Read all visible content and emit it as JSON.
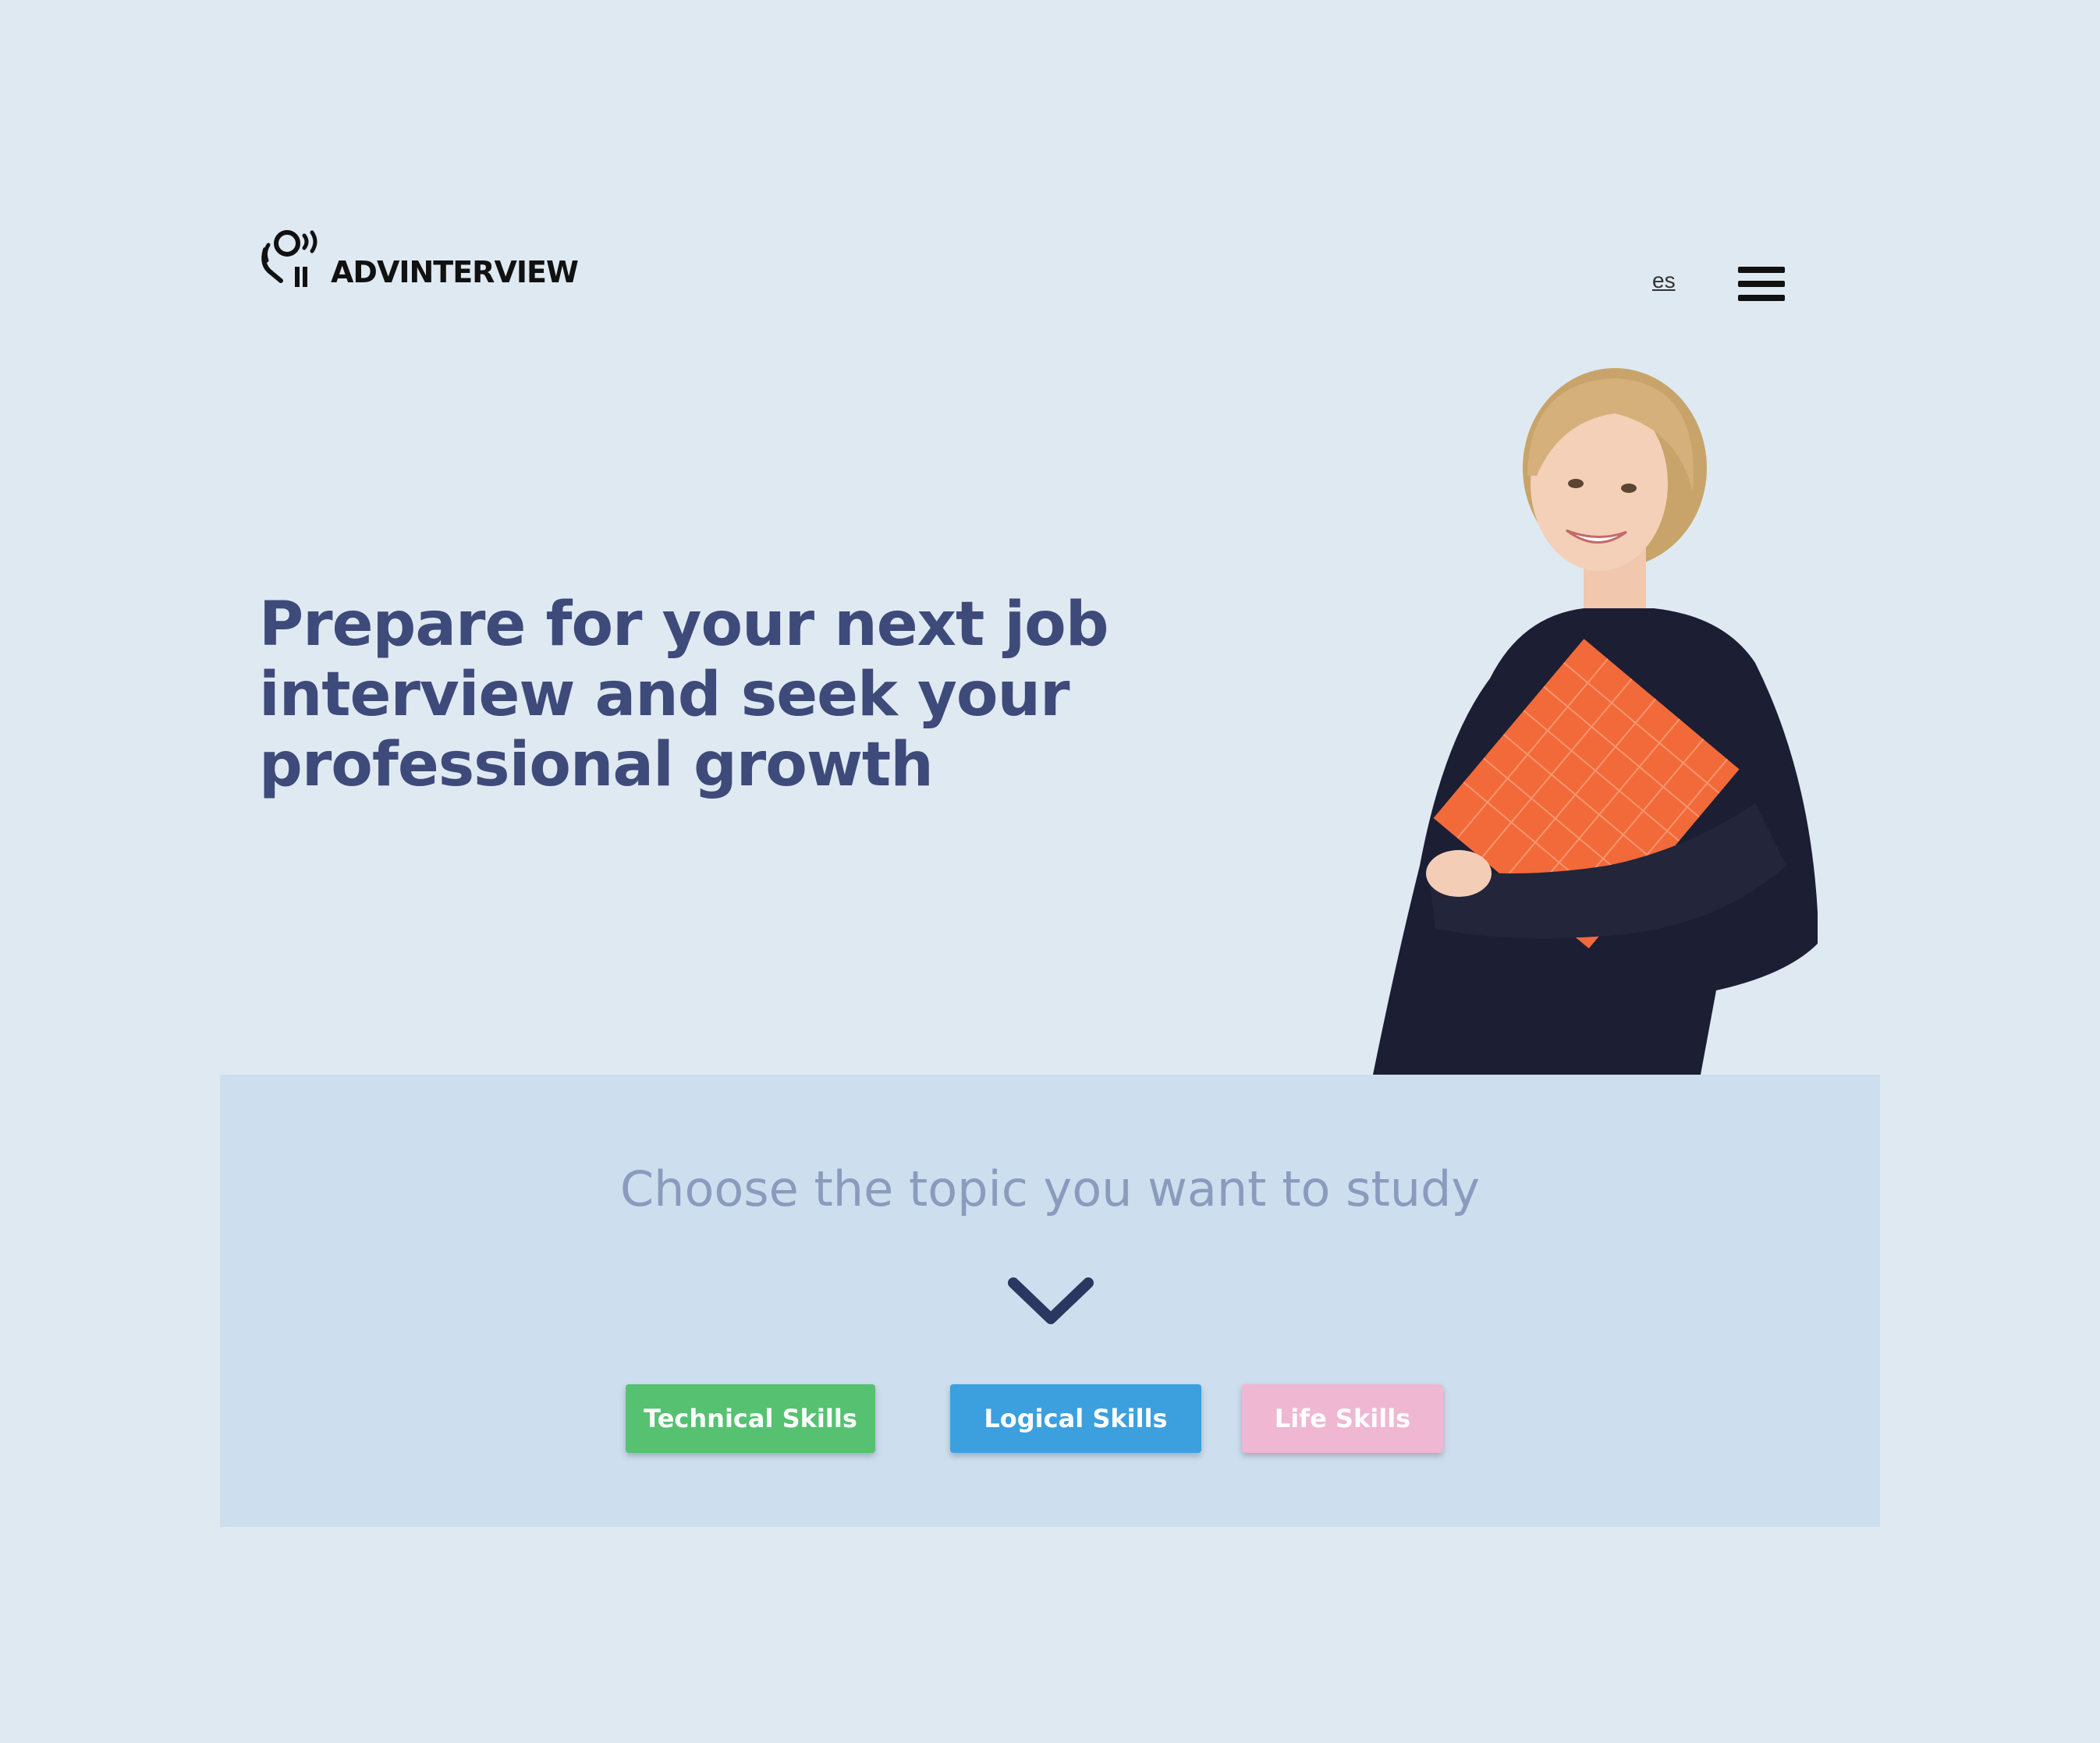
{
  "header": {
    "logo_text": "ADVINTERVIEW",
    "lang_link": "es",
    "menu_icon": "hamburger-menu-icon"
  },
  "hero": {
    "title": "Prepare for your next job interview and seek your professional growth",
    "image": "woman-holding-orange-folder"
  },
  "topics": {
    "heading": "Choose the topic you want to study",
    "chevron_icon": "chevron-down-icon",
    "buttons": {
      "technical": "Technical Skills",
      "logical": "Logical Skills",
      "life": "Life Skills"
    }
  },
  "colors": {
    "background": "#dfe9f2",
    "panel": "#cddeee",
    "title": "#3e4a7a",
    "technical": "#56c271",
    "logical": "#3da0de",
    "life": "#f0b7d3"
  }
}
